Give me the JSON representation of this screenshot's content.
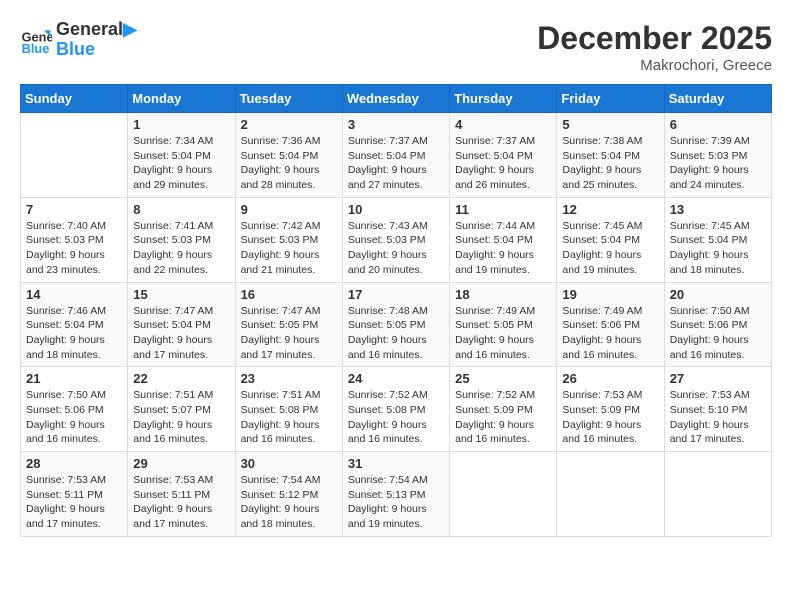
{
  "header": {
    "logo_line1": "General",
    "logo_line2": "Blue",
    "month": "December 2025",
    "location": "Makrochori, Greece"
  },
  "days_of_week": [
    "Sunday",
    "Monday",
    "Tuesday",
    "Wednesday",
    "Thursday",
    "Friday",
    "Saturday"
  ],
  "weeks": [
    [
      {
        "day": "",
        "info": ""
      },
      {
        "day": "1",
        "info": "Sunrise: 7:34 AM\nSunset: 5:04 PM\nDaylight: 9 hours\nand 29 minutes."
      },
      {
        "day": "2",
        "info": "Sunrise: 7:36 AM\nSunset: 5:04 PM\nDaylight: 9 hours\nand 28 minutes."
      },
      {
        "day": "3",
        "info": "Sunrise: 7:37 AM\nSunset: 5:04 PM\nDaylight: 9 hours\nand 27 minutes."
      },
      {
        "day": "4",
        "info": "Sunrise: 7:37 AM\nSunset: 5:04 PM\nDaylight: 9 hours\nand 26 minutes."
      },
      {
        "day": "5",
        "info": "Sunrise: 7:38 AM\nSunset: 5:04 PM\nDaylight: 9 hours\nand 25 minutes."
      },
      {
        "day": "6",
        "info": "Sunrise: 7:39 AM\nSunset: 5:03 PM\nDaylight: 9 hours\nand 24 minutes."
      }
    ],
    [
      {
        "day": "7",
        "info": "Sunrise: 7:40 AM\nSunset: 5:03 PM\nDaylight: 9 hours\nand 23 minutes."
      },
      {
        "day": "8",
        "info": "Sunrise: 7:41 AM\nSunset: 5:03 PM\nDaylight: 9 hours\nand 22 minutes."
      },
      {
        "day": "9",
        "info": "Sunrise: 7:42 AM\nSunset: 5:03 PM\nDaylight: 9 hours\nand 21 minutes."
      },
      {
        "day": "10",
        "info": "Sunrise: 7:43 AM\nSunset: 5:03 PM\nDaylight: 9 hours\nand 20 minutes."
      },
      {
        "day": "11",
        "info": "Sunrise: 7:44 AM\nSunset: 5:04 PM\nDaylight: 9 hours\nand 19 minutes."
      },
      {
        "day": "12",
        "info": "Sunrise: 7:45 AM\nSunset: 5:04 PM\nDaylight: 9 hours\nand 19 minutes."
      },
      {
        "day": "13",
        "info": "Sunrise: 7:45 AM\nSunset: 5:04 PM\nDaylight: 9 hours\nand 18 minutes."
      }
    ],
    [
      {
        "day": "14",
        "info": "Sunrise: 7:46 AM\nSunset: 5:04 PM\nDaylight: 9 hours\nand 18 minutes."
      },
      {
        "day": "15",
        "info": "Sunrise: 7:47 AM\nSunset: 5:04 PM\nDaylight: 9 hours\nand 17 minutes."
      },
      {
        "day": "16",
        "info": "Sunrise: 7:47 AM\nSunset: 5:05 PM\nDaylight: 9 hours\nand 17 minutes."
      },
      {
        "day": "17",
        "info": "Sunrise: 7:48 AM\nSunset: 5:05 PM\nDaylight: 9 hours\nand 16 minutes."
      },
      {
        "day": "18",
        "info": "Sunrise: 7:49 AM\nSunset: 5:05 PM\nDaylight: 9 hours\nand 16 minutes."
      },
      {
        "day": "19",
        "info": "Sunrise: 7:49 AM\nSunset: 5:06 PM\nDaylight: 9 hours\nand 16 minutes."
      },
      {
        "day": "20",
        "info": "Sunrise: 7:50 AM\nSunset: 5:06 PM\nDaylight: 9 hours\nand 16 minutes."
      }
    ],
    [
      {
        "day": "21",
        "info": "Sunrise: 7:50 AM\nSunset: 5:06 PM\nDaylight: 9 hours\nand 16 minutes."
      },
      {
        "day": "22",
        "info": "Sunrise: 7:51 AM\nSunset: 5:07 PM\nDaylight: 9 hours\nand 16 minutes."
      },
      {
        "day": "23",
        "info": "Sunrise: 7:51 AM\nSunset: 5:08 PM\nDaylight: 9 hours\nand 16 minutes."
      },
      {
        "day": "24",
        "info": "Sunrise: 7:52 AM\nSunset: 5:08 PM\nDaylight: 9 hours\nand 16 minutes."
      },
      {
        "day": "25",
        "info": "Sunrise: 7:52 AM\nSunset: 5:09 PM\nDaylight: 9 hours\nand 16 minutes."
      },
      {
        "day": "26",
        "info": "Sunrise: 7:53 AM\nSunset: 5:09 PM\nDaylight: 9 hours\nand 16 minutes."
      },
      {
        "day": "27",
        "info": "Sunrise: 7:53 AM\nSunset: 5:10 PM\nDaylight: 9 hours\nand 17 minutes."
      }
    ],
    [
      {
        "day": "28",
        "info": "Sunrise: 7:53 AM\nSunset: 5:11 PM\nDaylight: 9 hours\nand 17 minutes."
      },
      {
        "day": "29",
        "info": "Sunrise: 7:53 AM\nSunset: 5:11 PM\nDaylight: 9 hours\nand 17 minutes."
      },
      {
        "day": "30",
        "info": "Sunrise: 7:54 AM\nSunset: 5:12 PM\nDaylight: 9 hours\nand 18 minutes."
      },
      {
        "day": "31",
        "info": "Sunrise: 7:54 AM\nSunset: 5:13 PM\nDaylight: 9 hours\nand 19 minutes."
      },
      {
        "day": "",
        "info": ""
      },
      {
        "day": "",
        "info": ""
      },
      {
        "day": "",
        "info": ""
      }
    ]
  ]
}
